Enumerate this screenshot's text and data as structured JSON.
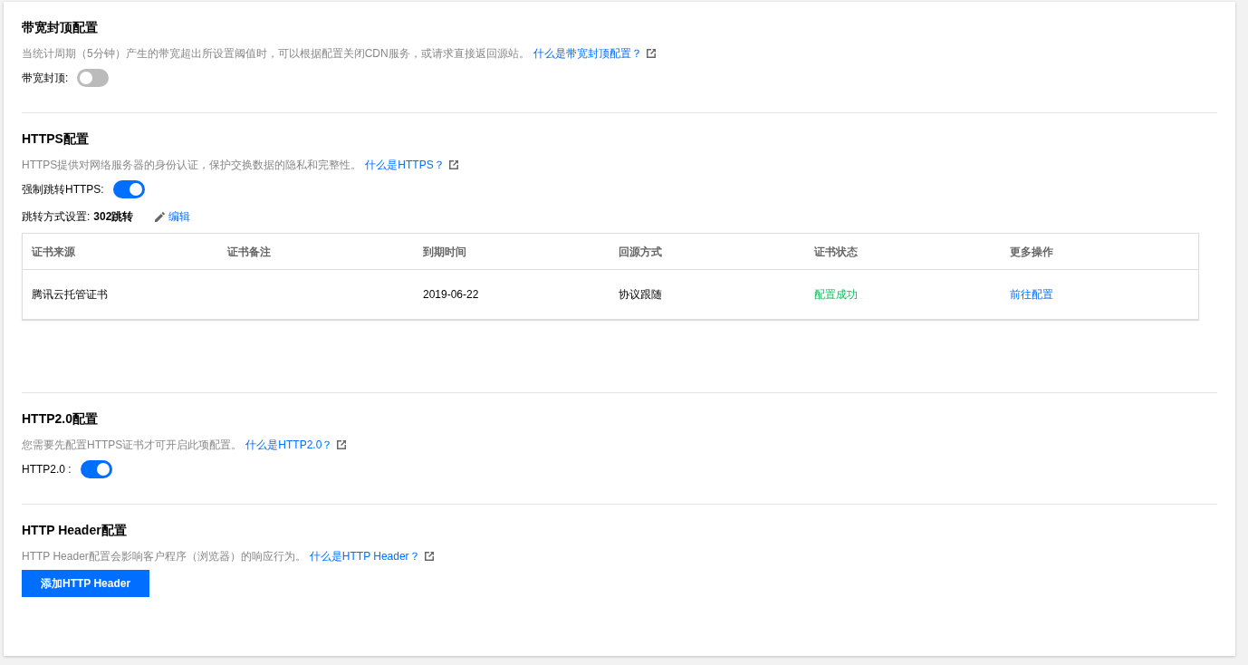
{
  "sections": [
    {
      "title": "带宽封顶配置",
      "description": "当统计周期（5分钟）产生的带宽超出所设置阈值时，可以根据配置关闭CDN服务，或请求直接返回源站。",
      "link": "什么是带宽封顶配置？",
      "items": [
        {
          "kind": "toggle",
          "label": "带宽封顶:",
          "on": false
        }
      ]
    },
    {
      "title": "HTTPS配置",
      "description": "HTTPS提供对网络服务器的身份认证，保护交换数据的隐私和完整性。",
      "link": "什么是HTTPS？",
      "items": [
        {
          "kind": "toggle",
          "label": "强制跳转HTTPS:",
          "on": true
        },
        {
          "kind": "setting",
          "label": "跳转方式设置:",
          "value": "302跳转",
          "action": "编辑"
        },
        {
          "kind": "table",
          "columns": [
            "证书来源",
            "证书备注",
            "到期时间",
            "回源方式",
            "证书状态",
            "更多操作"
          ],
          "rows": [
            [
              {
                "kind": "text",
                "text": "腾讯云托管证书"
              },
              {
                "kind": "text",
                "text": ""
              },
              {
                "kind": "text",
                "text": "2019-06-22"
              },
              {
                "kind": "text",
                "text": "协议跟随"
              },
              {
                "kind": "status",
                "text": "配置成功"
              },
              {
                "kind": "link",
                "text": "前往配置"
              }
            ]
          ]
        }
      ]
    },
    {
      "title": "HTTP2.0配置",
      "description": "您需要先配置HTTPS证书才可开启此项配置。",
      "link": "什么是HTTP2.0？",
      "items": [
        {
          "kind": "toggle",
          "label": "HTTP2.0 :",
          "on": true
        }
      ]
    },
    {
      "title": "HTTP Header配置",
      "description": "HTTP Header配置会影响客户程序（浏览器）的响应行为。",
      "link": "什么是HTTP Header？",
      "items": [
        {
          "kind": "button",
          "label": "添加HTTP Header"
        }
      ]
    }
  ]
}
